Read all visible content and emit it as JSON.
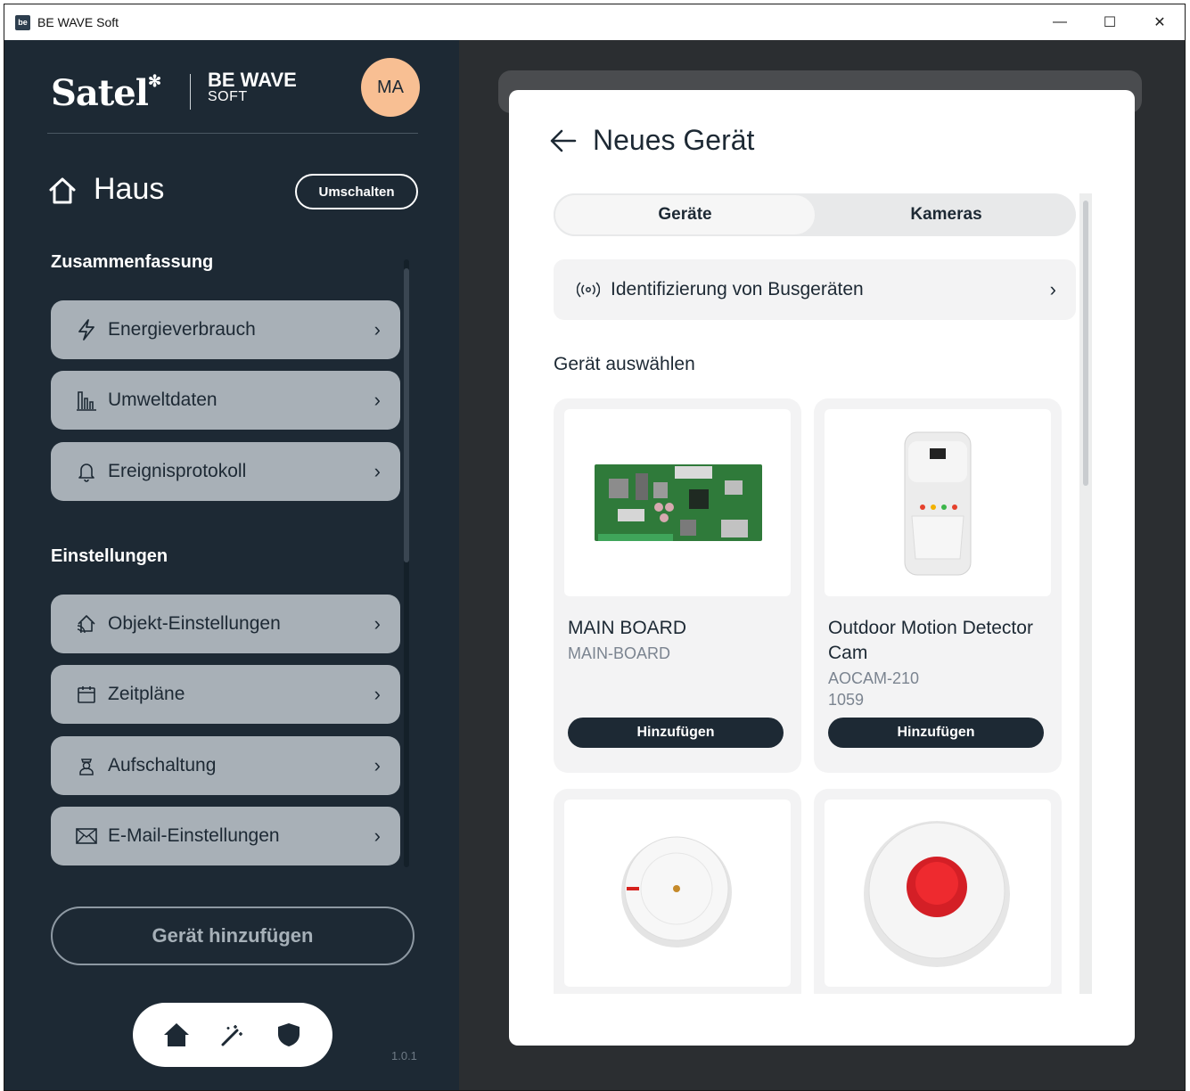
{
  "window": {
    "title": "BE WAVE Soft",
    "app_icon": "be",
    "controls": {
      "minimize": "—",
      "maximize": "☐",
      "close": "✕"
    }
  },
  "brand": {
    "logo": "Satel",
    "product": "BE WAVE",
    "product_sub": "SOFT",
    "avatar": "MA"
  },
  "home": {
    "title": "Haus",
    "switch_label": "Umschalten"
  },
  "summary": {
    "title": "Zusammenfassung",
    "items": [
      {
        "label": "Energieverbrauch",
        "icon": "lightning-icon"
      },
      {
        "label": "Umweltdaten",
        "icon": "bar-chart-icon"
      },
      {
        "label": "Ereignisprotokoll",
        "icon": "bell-icon"
      }
    ]
  },
  "settings": {
    "title": "Einstellungen",
    "items": [
      {
        "label": "Objekt-Einstellungen",
        "icon": "house-signal-icon"
      },
      {
        "label": "Zeitpläne",
        "icon": "calendar-icon"
      },
      {
        "label": "Aufschaltung",
        "icon": "guard-icon"
      },
      {
        "label": "E-Mail-Einstellungen",
        "icon": "mail-icon"
      }
    ]
  },
  "add_device_label": "Gerät hinzufügen",
  "bottom_nav": [
    "home-icon",
    "magic-wand-icon",
    "shield-icon"
  ],
  "version": "1.0.1",
  "dialog": {
    "title": "Neues Gerät",
    "tabs": [
      {
        "label": "Geräte",
        "active": true
      },
      {
        "label": "Kameras",
        "active": false
      }
    ],
    "bus_label": "Identifizierung von Busgeräten",
    "select_title": "Gerät auswählen",
    "devices": [
      {
        "name": "MAIN BOARD",
        "model": "MAIN-BOARD",
        "extra": "",
        "button": "Hinzufügen",
        "image": "circuit-board"
      },
      {
        "name": "Outdoor Motion Detector Cam",
        "model": "AOCAM-210",
        "extra": "1059",
        "button": "Hinzufügen",
        "image": "motion-detector"
      },
      {
        "name": "",
        "model": "",
        "extra": "",
        "button": "",
        "image": "smoke-detector"
      },
      {
        "name": "",
        "model": "",
        "extra": "",
        "button": "",
        "image": "siren"
      }
    ]
  },
  "colors": {
    "sidebar": "#1d2934",
    "accent_avatar": "#f8bf93",
    "nav_item": "#a8b0b7",
    "dialog_bg": "#ffffff",
    "button_dark": "#1d2934"
  }
}
